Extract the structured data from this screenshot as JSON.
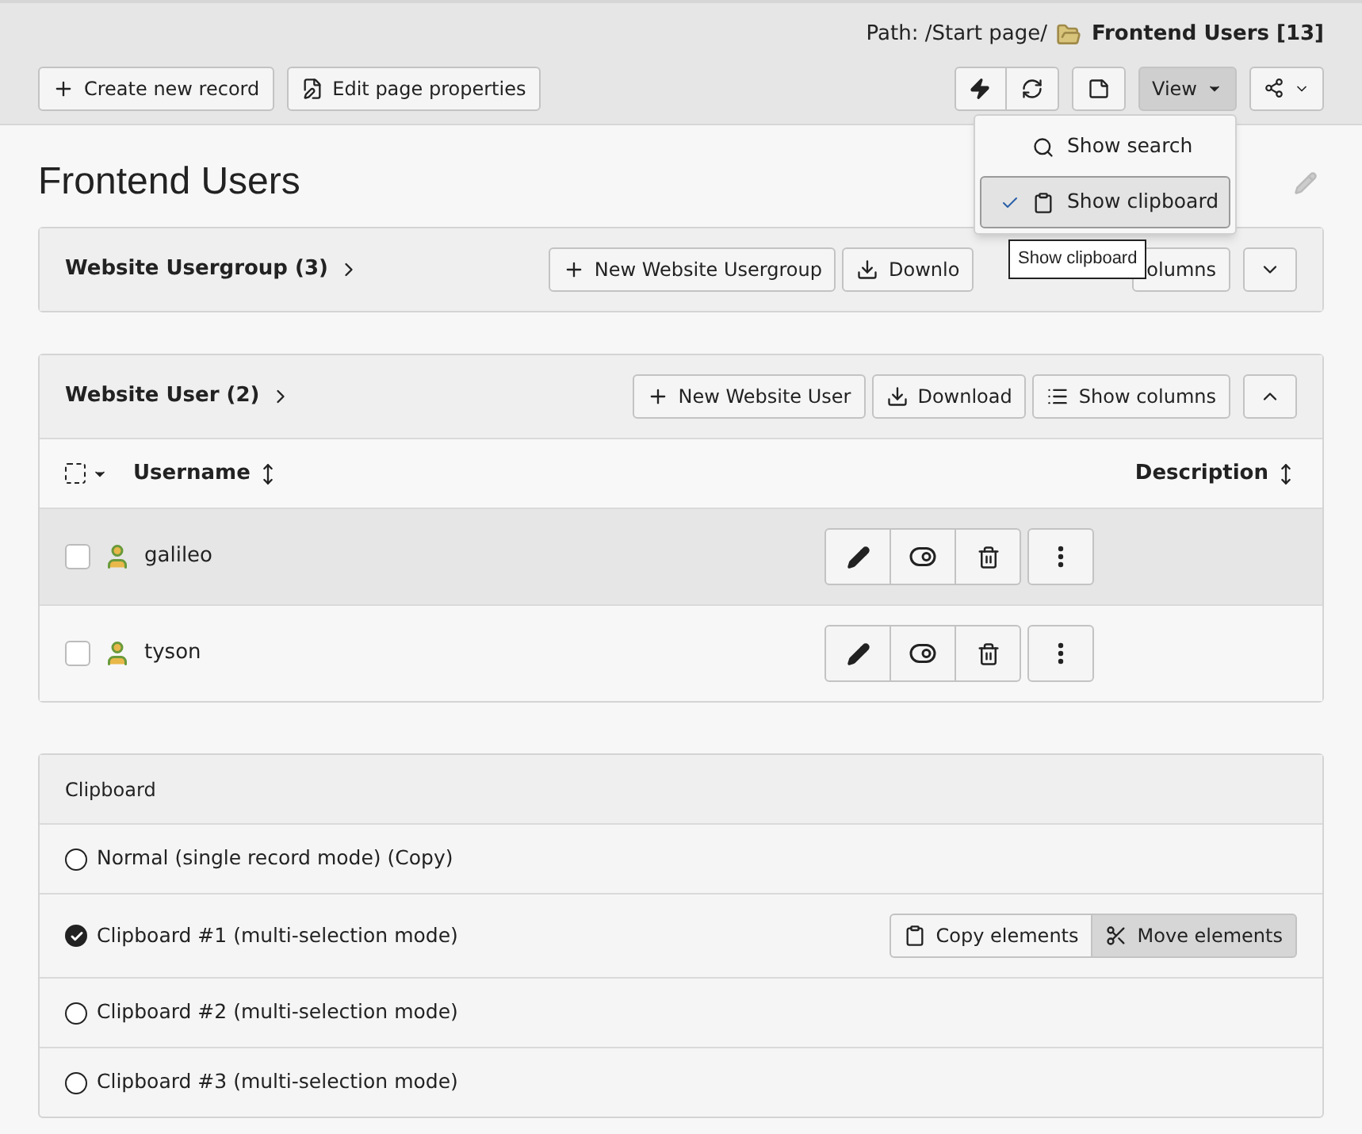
{
  "path": {
    "label": "Path: /Start page/",
    "page": "Frontend Users [13]"
  },
  "toolbar": {
    "left_buttons": [
      {
        "label": "Create new record",
        "kind": "create"
      },
      {
        "label": "Edit page properties",
        "kind": "edit"
      }
    ],
    "view_button": {
      "label": "View",
      "expanded": true
    }
  },
  "view_menu": [
    {
      "label": "Show search",
      "kind": "search",
      "selected": false
    },
    {
      "label": "Show clipboard",
      "kind": "clipboard",
      "selected": true
    }
  ],
  "tooltip": "Show clipboard",
  "heading": "Frontend Users",
  "tables": [
    {
      "title": "Website Usergroup (3)",
      "new_button": "New Website Usergroup",
      "download": "Downlo",
      "columns_button": "olumns",
      "expanded": false
    },
    {
      "title": "Website User (2)",
      "new_button": "New Website User",
      "download": "Download",
      "columns_button": "Show columns",
      "expanded": true,
      "all_selected": false,
      "columns": [
        "Username",
        "Description"
      ],
      "rows": [
        {
          "username": "galileo",
          "checked": false,
          "hovered": true
        },
        {
          "username": "tyson",
          "checked": false,
          "hovered": false
        }
      ]
    }
  ],
  "clipboard": {
    "title": "Clipboard",
    "options": [
      {
        "label": "Normal (single record mode) (Copy)",
        "selected": false
      },
      {
        "label": "Clipboard #1 (multi-selection mode)",
        "selected": true,
        "actions": [
          {
            "label": "Copy elements",
            "kind": "copy",
            "selected": false
          },
          {
            "label": "Move elements",
            "kind": "move",
            "selected": true
          }
        ]
      },
      {
        "label": "Clipboard #2 (multi-selection mode)",
        "selected": false
      },
      {
        "label": "Clipboard #3 (multi-selection mode)",
        "selected": false
      }
    ]
  }
}
